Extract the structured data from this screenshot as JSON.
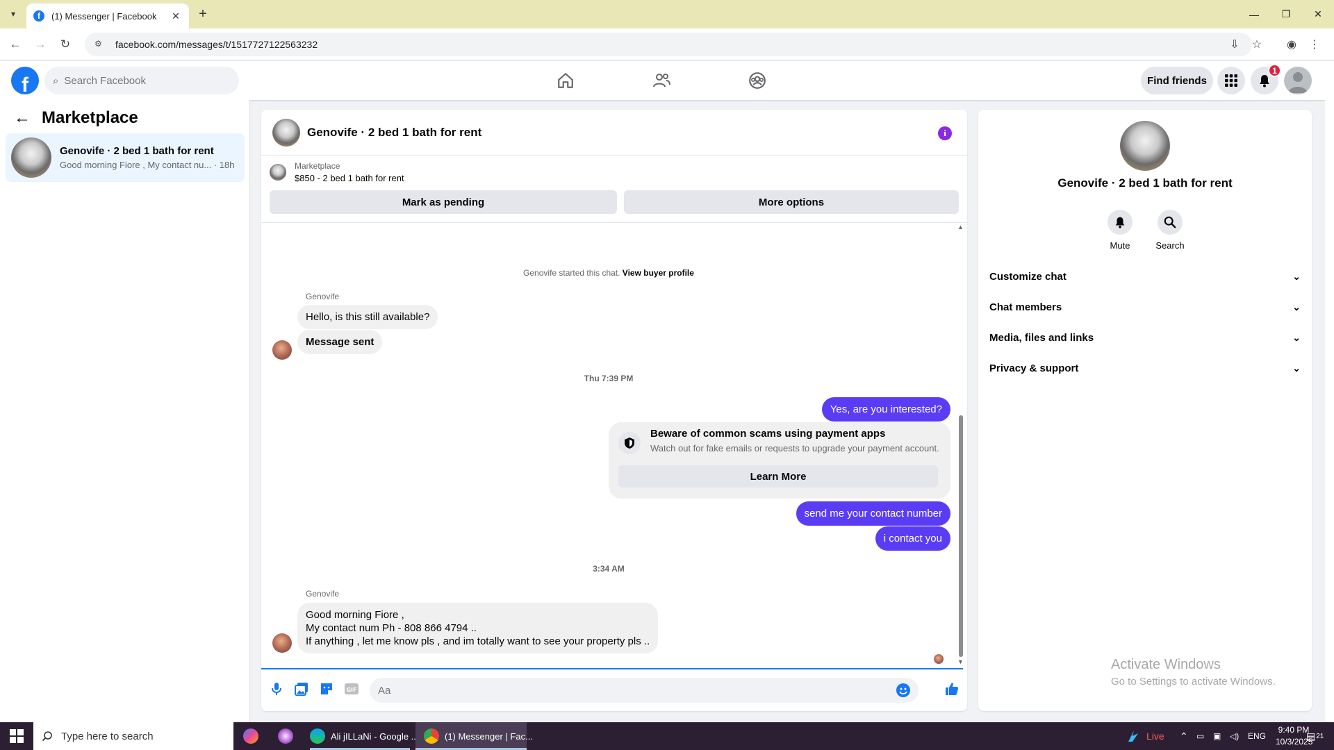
{
  "browser": {
    "tab_title": "(1) Messenger | Facebook",
    "url": "facebook.com/messages/t/1517727122563232"
  },
  "fb": {
    "search_placeholder": "Search Facebook",
    "find_friends": "Find friends",
    "notif_count": "1"
  },
  "left": {
    "title": "Marketplace",
    "thread_name": "Genovife · 2 bed 1 bath for rent",
    "thread_preview": "Good morning Fiore , My contact nu... · 18h"
  },
  "chat": {
    "title": "Genovife · 2 bed 1 bath for rent",
    "listing_source": "Marketplace",
    "listing_title": "$850 - 2 bed 1 bath for rent",
    "mark_pending": "Mark as pending",
    "more_options": "More options",
    "system_prefix": "Genovife started this chat.",
    "system_link": "View buyer profile",
    "sender_1": "Genovife",
    "msg_1": "Hello, is this still available?",
    "msg_2": "Message sent",
    "time_1": "Thu 7:39 PM",
    "out_1": "Yes, are you interested?",
    "scam_title": "Beware of common scams using payment apps",
    "scam_desc": "Watch out for fake emails or requests to upgrade your payment account.",
    "learn_more": "Learn More",
    "out_2": "send me your contact number",
    "out_3": "i contact you",
    "time_2": "3:34 AM",
    "sender_2": "Genovife",
    "msg_3_l1": "Good morning Fiore ,",
    "msg_3_l2": "My contact num Ph - 808 866 4794 ..",
    "msg_3_l3": "If anything , let me know pls , and im totally want to see your property pls ..",
    "input_placeholder": "Aa"
  },
  "right": {
    "name": "Genovife · 2 bed 1 bath for rent",
    "mute": "Mute",
    "search": "Search",
    "rows": [
      "Customize chat",
      "Chat members",
      "Media, files and links",
      "Privacy & support"
    ]
  },
  "watermark": {
    "line1": "Activate Windows",
    "line2": "Go to Settings to activate Windows."
  },
  "taskbar": {
    "search_placeholder": "Type here to search",
    "app_edge": "Ali jILLaNi - Google ...",
    "app_chrome": "(1) Messenger | Fac...",
    "live": "Live",
    "lang": "ENG",
    "time": "9:40 PM",
    "date": "10/3/2025",
    "notif": "21"
  },
  "colors": {
    "fb_blue": "#1877f2",
    "outgoing_bubble": "#5b3cf5",
    "badge_red": "#e41e3f"
  }
}
